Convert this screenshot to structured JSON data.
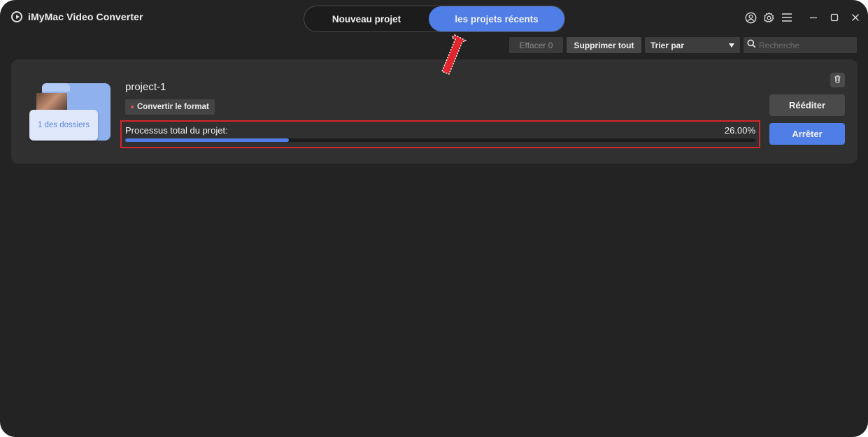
{
  "app": {
    "title": "iMyMac Video Converter"
  },
  "tabs": [
    {
      "label": "Nouveau projet",
      "active": false
    },
    {
      "label": "les projets récents",
      "active": true
    }
  ],
  "toolbar": {
    "clear_label": "Effacer 0",
    "delete_all_label": "Supprimer tout",
    "sort_label": "Trier par",
    "search_placeholder": "Recherche"
  },
  "project": {
    "name": "project-1",
    "tag": "Convertir le format",
    "folder_label": "1 des dossiers",
    "progress_label": "Processus total du projet:",
    "progress_text": "26.00%",
    "progress_value": 0.26,
    "reedit_label": "Rééditer",
    "stop_label": "Arrêter"
  },
  "icons": {
    "top_right": [
      "user-icon",
      "gear-icon",
      "menu-icon"
    ],
    "window": [
      "minimize-icon",
      "maximize-icon",
      "close-icon"
    ]
  },
  "colors": {
    "accent": "#4f7ee6",
    "highlight_border": "#d7252d",
    "background": "#232323",
    "card": "#303030"
  }
}
